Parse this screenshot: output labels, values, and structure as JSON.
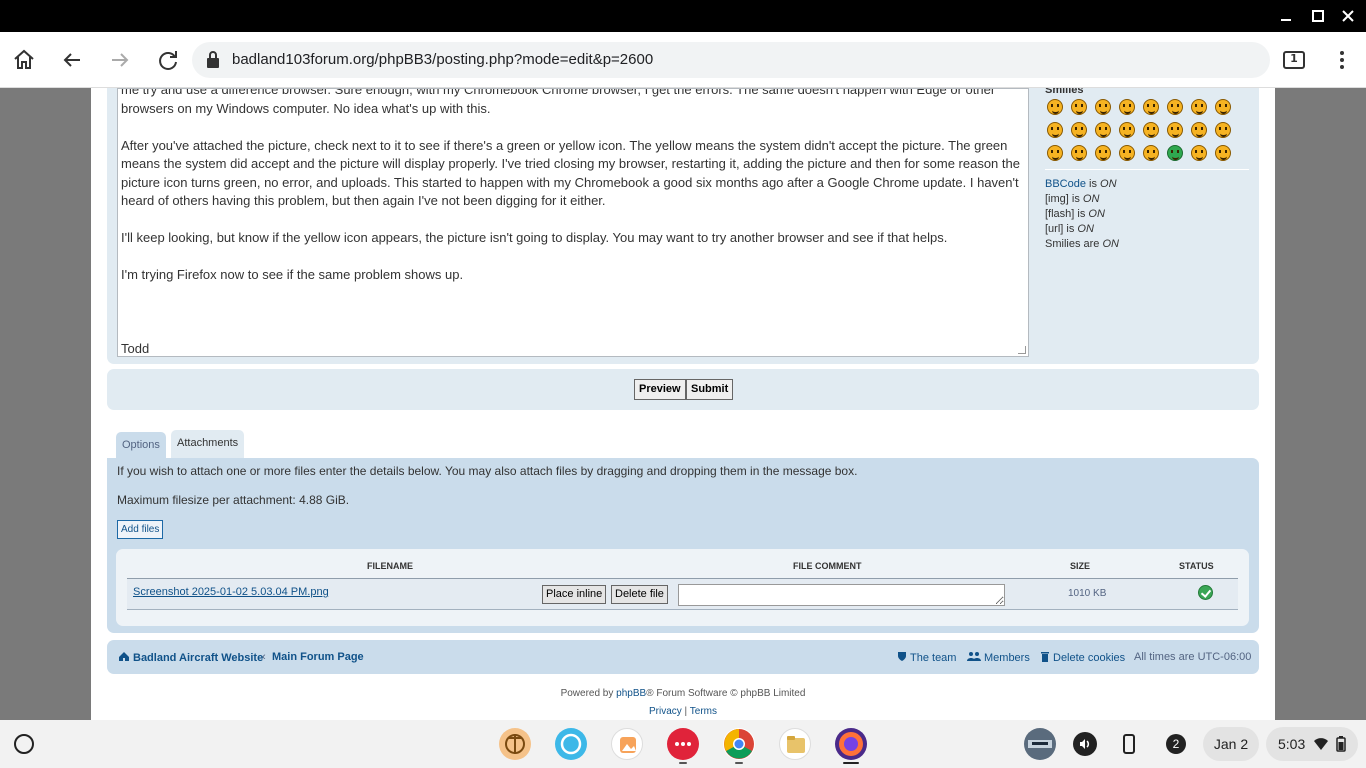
{
  "browser": {
    "url": "badland103forum.org/phpBB3/posting.php?mode=edit&p=2600",
    "tab_count": "1"
  },
  "editor": {
    "paragraphs": [
      "me try and use a difference browser. Sure enough, with my Chromebook Chrome browser, I get the errors. The same doesn't happen with Edge or other browsers on my Windows computer. No idea what's up with this.",
      "After you've attached the picture, check next to it to see if there's a green or yellow icon. The yellow means the system didn't accept the picture. The green means the system did accept and the picture will display properly. I've tried closing my browser, restarting it, adding the picture and then for some reason the picture icon turns green, no error, and uploads. This started to happen with my Chromebook a good six months ago after a Google Chrome update. I haven't heard of others having this problem, but then again I've not been digging for it either.",
      "I'll keep looking, but know if the yellow icon appears, the picture isn't going to display. You may want to try another browser and see if that helps.",
      "I'm trying Firefox now to see if the same problem shows up.",
      "Todd"
    ]
  },
  "smilies": {
    "title": "Smilies",
    "bbcode_link": "BBCode",
    "bbcode_is": " is ",
    "bbcode_state": "ON",
    "img_label": "[img] is ",
    "img_state": "ON",
    "flash_label": "[flash] is ",
    "flash_state": "ON",
    "url_label": "[url] is ",
    "url_state": "ON",
    "smilies_label": "Smilies are ",
    "smilies_state": "ON"
  },
  "actions": {
    "preview": "Preview",
    "submit": "Submit"
  },
  "tabs": {
    "options": "Options",
    "attachments": "Attachments"
  },
  "attachments": {
    "intro": "If you wish to attach one or more files enter the details below. You may also attach files by dragging and dropping them in the message box.",
    "max_size": "Maximum filesize per attachment: 4.88 GiB.",
    "add_files": "Add files",
    "headers": {
      "filename": "FILENAME",
      "comment": "FILE COMMENT",
      "size": "SIZE",
      "status": "STATUS"
    },
    "files": [
      {
        "name": "Screenshot 2025-01-02 5.03.04 PM.png",
        "place_inline": "Place inline",
        "delete": "Delete file",
        "comment": "",
        "size": "1010 KB",
        "status": "ok"
      }
    ]
  },
  "footer": {
    "site_link": "Badland Aircraft Website",
    "separator": "‹",
    "forum_link": "Main Forum Page",
    "team": "The team",
    "members": "Members",
    "delete_cookies": "Delete cookies",
    "timezone": "All times are UTC-06:00",
    "powered_prefix": "Powered by ",
    "powered_link": "phpBB",
    "powered_suffix": "® Forum Software © phpBB Limited",
    "privacy": "Privacy",
    "pipe": " | ",
    "terms": "Terms"
  },
  "shelf": {
    "date": "Jan 2",
    "time": "5:03",
    "notification_count": "2"
  },
  "colors": {
    "link": "#105289",
    "panel": "#cadceb",
    "panel_light": "#e1ebf2"
  }
}
